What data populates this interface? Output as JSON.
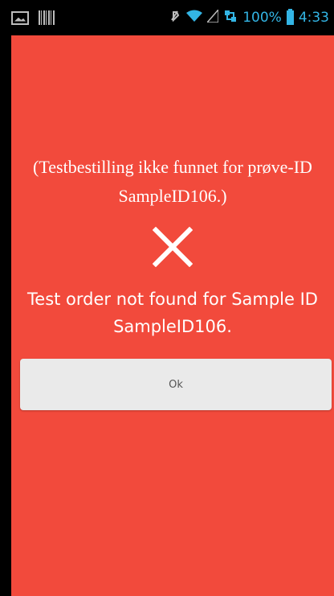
{
  "status_bar": {
    "battery_percent": "100%",
    "time": "4:33",
    "icons": [
      "image-icon",
      "barcode-icon",
      "mute-icon",
      "wifi-icon",
      "signal-icon",
      "data-icon",
      "battery-icon"
    ]
  },
  "dialog": {
    "localized_message": "(Testbestilling ikke funnet for prøve-ID SampleID106.)",
    "message": "Test order not found for Sample ID SampleID106.",
    "ok_label": "Ok",
    "background_color": "#f24a3c",
    "icon": "close-icon"
  }
}
